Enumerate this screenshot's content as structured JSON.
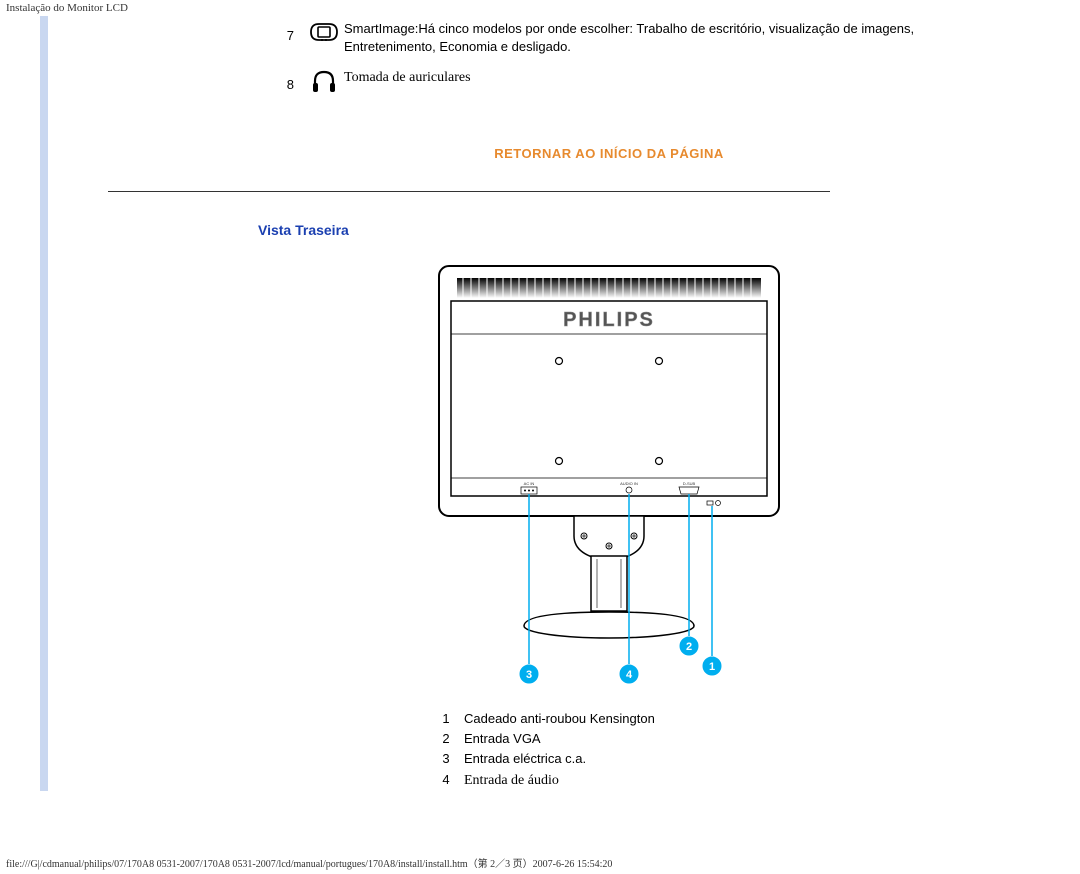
{
  "header": "Instalação do Monitor LCD",
  "row7": {
    "num": "7",
    "text": "SmartImage:Há cinco modelos por onde escolher: Trabalho de escritório, visualização de imagens, Entretenimento, Economia e desligado."
  },
  "row8": {
    "num": "8",
    "text": "Tomada de auriculares"
  },
  "return_link": "RETORNAR AO INÍCIO DA PÁGINA",
  "section_title": "Vista Traseira",
  "brand": "PHILIPS",
  "port_labels": {
    "ac": "AC IN",
    "audio": "AUDIO IN",
    "dsub": "D-SUB"
  },
  "callouts": {
    "c1": "1",
    "c2": "2",
    "c3": "3",
    "c4": "4"
  },
  "legend": [
    {
      "n": "1",
      "t": "Cadeado anti-roubou Kensington"
    },
    {
      "n": "2",
      "t": "Entrada VGA"
    },
    {
      "n": "3",
      "t": "Entrada eléctrica c.a."
    },
    {
      "n": "4",
      "t": "Entrada de áudio"
    }
  ],
  "footer": "file:///G|/cdmanual/philips/07/170A8 0531-2007/170A8 0531-2007/lcd/manual/portugues/170A8/install/install.htm（第 2／3 页）2007-6-26 15:54:20"
}
